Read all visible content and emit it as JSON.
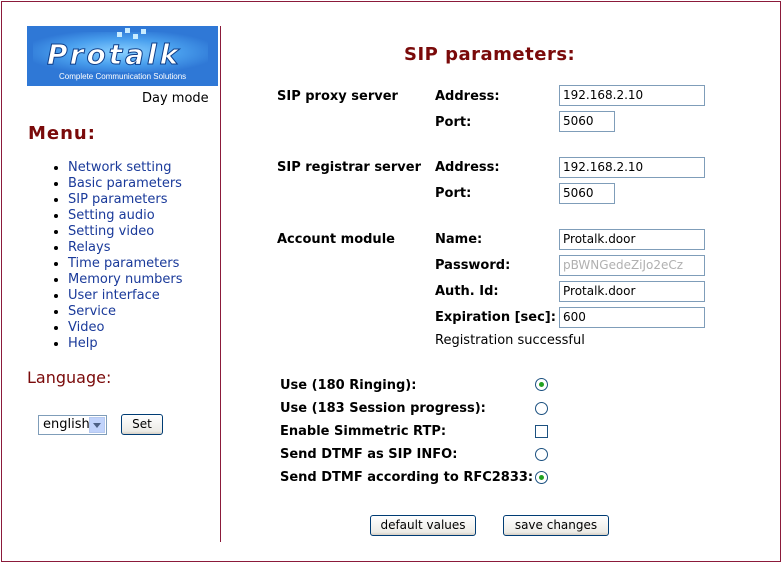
{
  "brand": {
    "logo_text": "Protalk",
    "tagline": "Complete Communication Solutions"
  },
  "day_mode": "Day mode",
  "menu": {
    "title": "Menu:",
    "items": [
      "Network setting",
      "Basic parameters",
      "SIP parameters",
      "Setting audio",
      "Setting video",
      "Relays",
      "Time parameters",
      "Memory numbers",
      "User interface",
      "Service",
      "Video",
      "Help"
    ]
  },
  "language": {
    "title": "Language:",
    "selected": "english",
    "set_label": "Set"
  },
  "page_title": "SIP parameters:",
  "proxy": {
    "section": "SIP proxy server",
    "address_label": "Address:",
    "address": "192.168.2.10",
    "port_label": "Port:",
    "port": "5060"
  },
  "registrar": {
    "section": "SIP registrar server",
    "address_label": "Address:",
    "address": "192.168.2.10",
    "port_label": "Port:",
    "port": "5060"
  },
  "account": {
    "section": "Account module",
    "name_label": "Name:",
    "name": "Protalk.door",
    "password_label": "Password:",
    "password": "pBWNGedeZiJo2eCz",
    "auth_label": "Auth. Id:",
    "auth": "Protalk.door",
    "expiration_label": "Expiration [sec]:",
    "expiration": "600",
    "status": "Registration successful"
  },
  "options": {
    "use180": "Use (180 Ringing):",
    "use183": "Use (183 Session progress):",
    "simmetric": "Enable Simmetric RTP:",
    "dtmf_info": "Send DTMF as SIP INFO:",
    "dtmf_rfc": "Send DTMF according to RFC2833:"
  },
  "buttons": {
    "default": "default values",
    "save": "save changes"
  },
  "colors": {
    "accent": "#7a0a0a",
    "link": "#1a3a9a",
    "border": "#8b1a3a"
  }
}
